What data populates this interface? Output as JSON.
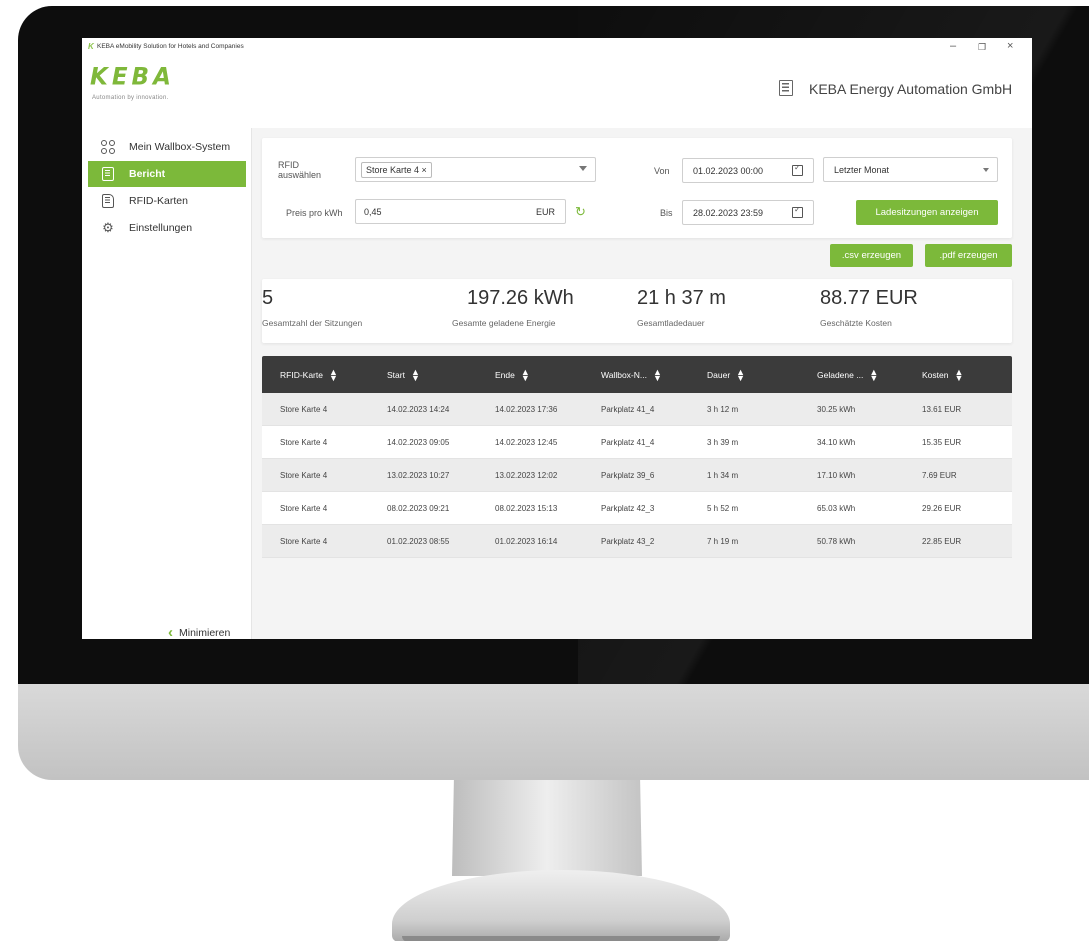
{
  "window": {
    "title": "KEBA eMobility Solution for Hotels and Companies",
    "controls": {
      "minimize": "–",
      "maximize": "❐",
      "close": "×"
    }
  },
  "header": {
    "logo_text": "KEBA",
    "logo_tagline": "Automation by innovation.",
    "company_name": "KEBA Energy Automation GmbH"
  },
  "sidebar": {
    "items": [
      {
        "label": "Mein Wallbox-System",
        "icon": "wallbox-grid-icon",
        "active": false
      },
      {
        "label": "Bericht",
        "icon": "report-document-icon",
        "active": true
      },
      {
        "label": "RFID-Karten",
        "icon": "rfid-card-icon",
        "active": false
      },
      {
        "label": "Einstellungen",
        "icon": "settings-gear-icon",
        "active": false
      }
    ],
    "minimize_label": "Minimieren"
  },
  "filters": {
    "rfid_label_line1": "RFID",
    "rfid_label_line2": "auswählen",
    "rfid_chip": "Store Karte 4 ×",
    "price_label": "Preis pro kWh",
    "price_value": "0,45",
    "price_unit": "EUR",
    "from_label": "Von",
    "from_value": "01.02.2023 00:00",
    "to_label": "Bis",
    "to_value": "28.02.2023 23:59",
    "period_value": "Letzter Monat",
    "show_sessions_button": "Ladesitzungen anzeigen",
    "csv_button": ".csv erzeugen",
    "pdf_button": ".pdf erzeugen"
  },
  "stats": [
    {
      "value": "5",
      "label": "Gesamtzahl der Sitzungen"
    },
    {
      "value": "197.26 kWh",
      "label": "Gesamte geladene Energie"
    },
    {
      "value": "21 h 37 m",
      "label": "Gesamtladedauer"
    },
    {
      "value": "88.77 EUR",
      "label": "Geschätzte Kosten"
    }
  ],
  "table": {
    "columns": [
      "RFID-Karte",
      "Start",
      "Ende",
      "Wallbox-N...",
      "Dauer",
      "Geladene ...",
      "Kosten"
    ],
    "rows": [
      [
        "Store Karte 4",
        "14.02.2023 14:24",
        "14.02.2023 17:36",
        "Parkplatz 41_4",
        "3 h 12 m",
        "30.25 kWh",
        "13.61 EUR"
      ],
      [
        "Store Karte 4",
        "14.02.2023 09:05",
        "14.02.2023 12:45",
        "Parkplatz 41_4",
        "3 h 39 m",
        "34.10 kWh",
        "15.35 EUR"
      ],
      [
        "Store Karte 4",
        "13.02.2023 10:27",
        "13.02.2023 12:02",
        "Parkplatz 39_6",
        "1 h 34 m",
        "17.10 kWh",
        "7.69 EUR"
      ],
      [
        "Store Karte 4",
        "08.02.2023 09:21",
        "08.02.2023 15:13",
        "Parkplatz 42_3",
        "5 h 52 m",
        "65.03 kWh",
        "29.26 EUR"
      ],
      [
        "Store Karte 4",
        "01.02.2023 08:55",
        "01.02.2023 16:14",
        "Parkplatz 43_2",
        "7 h 19 m",
        "50.78 kWh",
        "22.85 EUR"
      ]
    ]
  },
  "colors": {
    "accent_green": "#7cb93a",
    "table_header": "#3b3b3b"
  }
}
